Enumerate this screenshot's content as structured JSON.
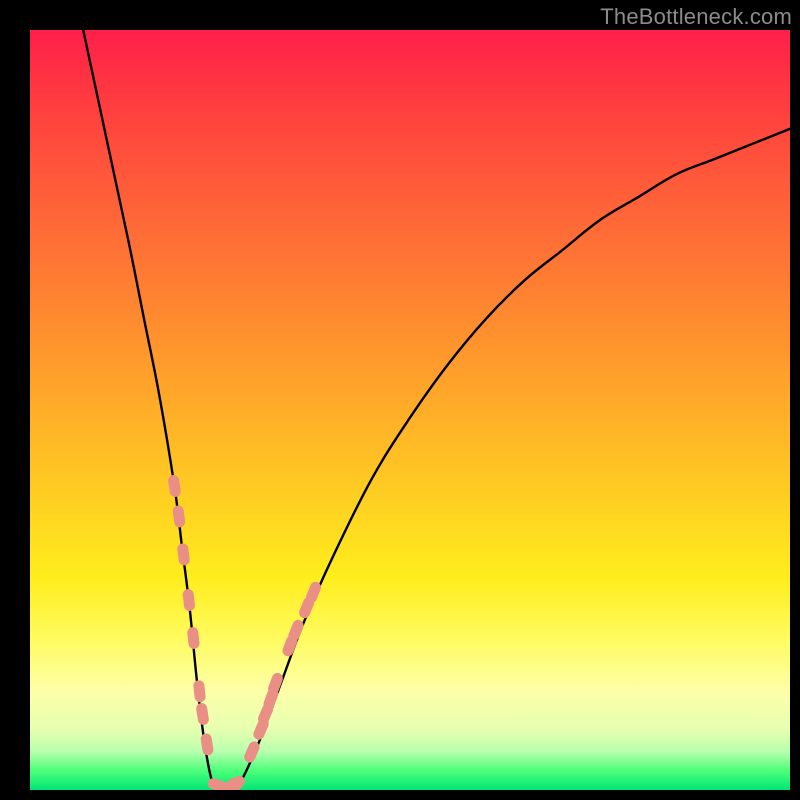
{
  "watermark": "TheBottleneck.com",
  "colors": {
    "frame_bg": "#000000",
    "curve": "#000000",
    "marker_fill": "#e98f86",
    "marker_stroke": "#e98f86",
    "gradient_top": "#ff1f4a",
    "gradient_bottom": "#00e676"
  },
  "chart_data": {
    "type": "line",
    "title": "",
    "xlabel": "",
    "ylabel": "",
    "xlim": [
      0,
      100
    ],
    "ylim": [
      0,
      100
    ],
    "grid": false,
    "legend": false,
    "note": "Axes unlabeled in source; valley-shaped bottleneck curve. x is normalized position 0–100 across plot width, y is 0 at bottom (green) to 100 at top (red). Values estimated from pixel positions.",
    "series": [
      {
        "name": "bottleneck-curve",
        "x": [
          7,
          10,
          13,
          15,
          17,
          19,
          20,
          21,
          22,
          23,
          24,
          25,
          27,
          30,
          33,
          36,
          40,
          45,
          50,
          55,
          60,
          65,
          70,
          75,
          80,
          85,
          90,
          95,
          100
        ],
        "y": [
          100,
          86,
          72,
          62,
          52,
          40,
          32,
          24,
          14,
          6,
          1,
          0,
          0,
          6,
          14,
          22,
          31,
          41,
          49,
          56,
          62,
          67,
          71,
          75,
          78,
          81,
          83,
          85,
          87
        ]
      }
    ],
    "markers": {
      "name": "highlighted-segments",
      "note": "Pink rounded markers clustered near valley on both branches and along the flat bottom.",
      "points": [
        {
          "x": 19,
          "y": 40
        },
        {
          "x": 19.6,
          "y": 36
        },
        {
          "x": 20.2,
          "y": 31
        },
        {
          "x": 20.9,
          "y": 25
        },
        {
          "x": 21.5,
          "y": 20
        },
        {
          "x": 22.3,
          "y": 13
        },
        {
          "x": 22.7,
          "y": 10
        },
        {
          "x": 23.3,
          "y": 6
        },
        {
          "x": 24.8,
          "y": 0.6
        },
        {
          "x": 25.5,
          "y": 0.3
        },
        {
          "x": 26.3,
          "y": 0.3
        },
        {
          "x": 27.1,
          "y": 0.6
        },
        {
          "x": 29.2,
          "y": 5
        },
        {
          "x": 30.4,
          "y": 8
        },
        {
          "x": 31.0,
          "y": 10
        },
        {
          "x": 31.7,
          "y": 12
        },
        {
          "x": 32.3,
          "y": 14
        },
        {
          "x": 34.2,
          "y": 19
        },
        {
          "x": 35.0,
          "y": 21
        },
        {
          "x": 36.4,
          "y": 24
        },
        {
          "x": 37.3,
          "y": 26
        }
      ]
    }
  }
}
